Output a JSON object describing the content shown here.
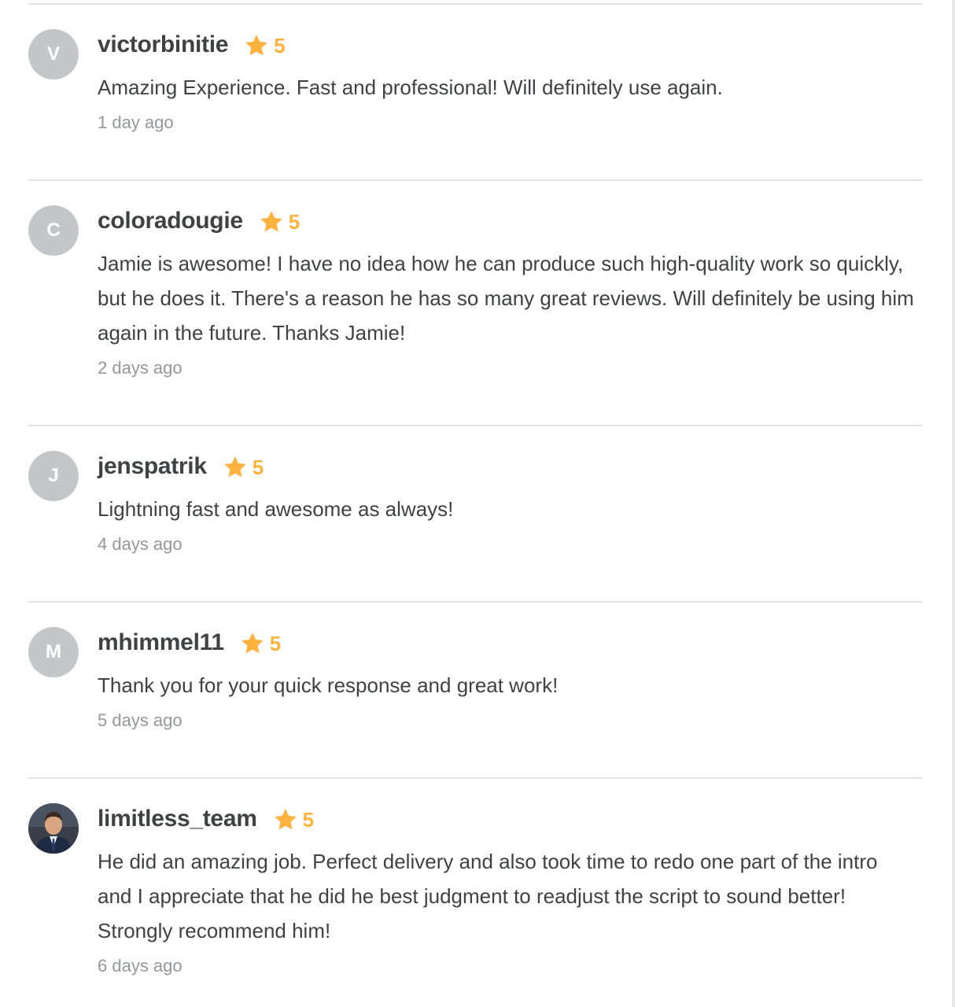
{
  "colors": {
    "divider": "#e4e5e7",
    "avatar_bg": "#c5c6c9",
    "star": "#ffb33e",
    "text": "#404145",
    "muted": "#95979d"
  },
  "reviews": [
    {
      "initial": "V",
      "username": "victorbinitie",
      "rating": "5",
      "text": "Amazing Experience. Fast and professional! Will definitely use again.",
      "date": "1 day ago"
    },
    {
      "initial": "C",
      "username": "coloradougie",
      "rating": "5",
      "text": "Jamie is awesome! I have no idea how he can produce such high-quality work so quickly, but he does it. There's a reason he has so many great reviews. Will definitely be using him again in the future. Thanks Jamie!",
      "date": "2 days ago"
    },
    {
      "initial": "J",
      "username": "jenspatrik",
      "rating": "5",
      "text": "Lightning fast and awesome as always!",
      "date": "4 days ago"
    },
    {
      "initial": "M",
      "username": "mhimmel11",
      "rating": "5",
      "text": "Thank you for your quick response and great work!",
      "date": "5 days ago"
    },
    {
      "avatar_icon": "user-photo",
      "username": "limitless_team",
      "rating": "5",
      "text": "He did an amazing job. Perfect delivery and also took time to redo one part of the intro and I appreciate that he did he best judgment to readjust the script to sound better! Strongly recommend him!",
      "date": "6 days ago"
    }
  ]
}
